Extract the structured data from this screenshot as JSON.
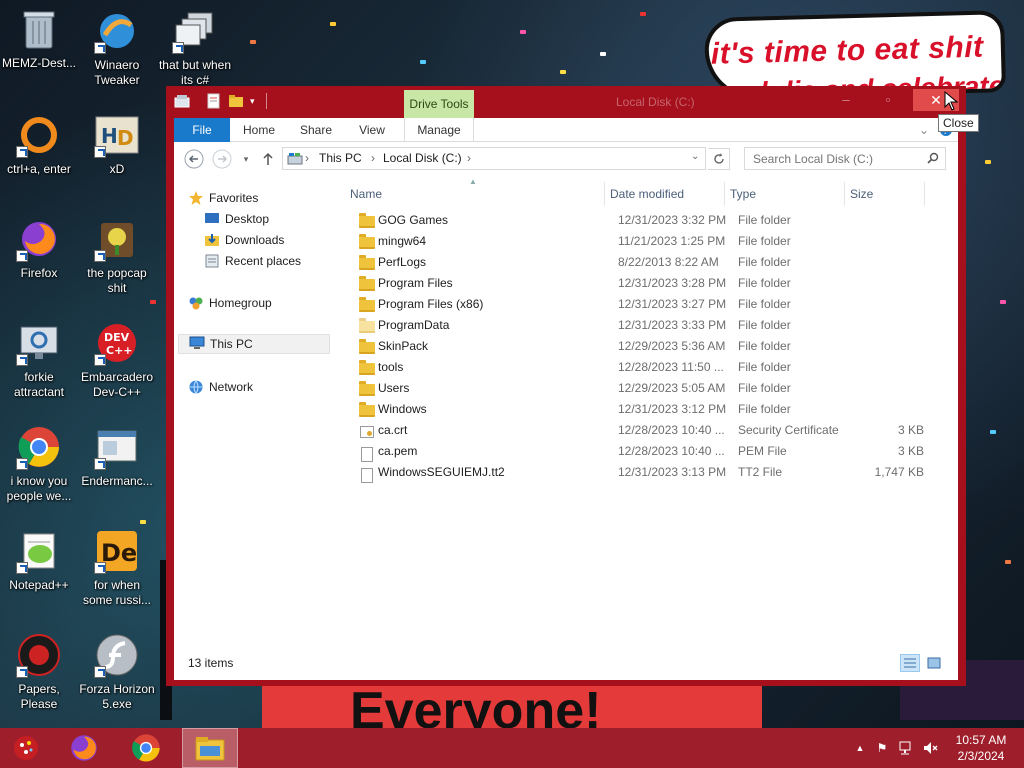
{
  "desktop": {
    "icons": [
      {
        "label": "MEMZ-Dest..."
      },
      {
        "label": "Winaero Tweaker"
      },
      {
        "label": "that but when its c#"
      },
      {
        "label": "ctrl+a, enter"
      },
      {
        "label": "xD"
      },
      {
        "label": "Firefox"
      },
      {
        "label": "the popcap shit"
      },
      {
        "label": "forkie attractant"
      },
      {
        "label": "Embarcadero Dev-C++"
      },
      {
        "label": "i know you people we..."
      },
      {
        "label": "Endermanc..."
      },
      {
        "label": "Notepad++"
      },
      {
        "label": "for when some russi..."
      },
      {
        "label": "Papers, Please"
      },
      {
        "label": "Forza Horizon 5.exe"
      }
    ],
    "wallpaper": {
      "bubble_line1": "it's time to eat shit",
      "bubble_line2": "and die and celebrate",
      "banner": "Everyone!"
    }
  },
  "window": {
    "title": "Local Disk (C:)",
    "context_tab": "Drive Tools",
    "close_tooltip": "Close",
    "ribbon_tabs": [
      "File",
      "Home",
      "Share",
      "View",
      "Manage"
    ],
    "address": {
      "crumbs": [
        "This PC",
        "Local Disk (C:)"
      ]
    },
    "search": {
      "placeholder": "Search Local Disk (C:)"
    },
    "nav_pane": {
      "favorites": "Favorites",
      "favorites_items": [
        "Desktop",
        "Downloads",
        "Recent places"
      ],
      "homegroup": "Homegroup",
      "this_pc": "This PC",
      "network": "Network"
    },
    "columns": {
      "name": "Name",
      "date": "Date modified",
      "type": "Type",
      "size": "Size"
    },
    "files": [
      {
        "name": "GOG Games",
        "date": "12/31/2023 3:32 PM",
        "type": "File folder",
        "size": ""
      },
      {
        "name": "mingw64",
        "date": "11/21/2023 1:25 PM",
        "type": "File folder",
        "size": ""
      },
      {
        "name": "PerfLogs",
        "date": "8/22/2013 8:22 AM",
        "type": "File folder",
        "size": ""
      },
      {
        "name": "Program Files",
        "date": "12/31/2023 3:28 PM",
        "type": "File folder",
        "size": ""
      },
      {
        "name": "Program Files (x86)",
        "date": "12/31/2023 3:27 PM",
        "type": "File folder",
        "size": ""
      },
      {
        "name": "ProgramData",
        "date": "12/31/2023 3:33 PM",
        "type": "File folder",
        "size": ""
      },
      {
        "name": "SkinPack",
        "date": "12/29/2023 5:36 AM",
        "type": "File folder",
        "size": ""
      },
      {
        "name": "tools",
        "date": "12/28/2023 11:50 ...",
        "type": "File folder",
        "size": ""
      },
      {
        "name": "Users",
        "date": "12/29/2023 5:05 AM",
        "type": "File folder",
        "size": ""
      },
      {
        "name": "Windows",
        "date": "12/31/2023 3:12 PM",
        "type": "File folder",
        "size": ""
      },
      {
        "name": "ca.crt",
        "date": "12/28/2023 10:40 ...",
        "type": "Security Certificate",
        "size": "3 KB"
      },
      {
        "name": "ca.pem",
        "date": "12/28/2023 10:40 ...",
        "type": "PEM File",
        "size": "3 KB"
      },
      {
        "name": "WindowsSEGUIEMJ.tt2",
        "date": "12/31/2023 3:13 PM",
        "type": "TT2 File",
        "size": "1,747 KB"
      }
    ],
    "status": {
      "item_count": "13 items"
    }
  },
  "taskbar": {
    "clock_time": "10:57 AM",
    "clock_date": "2/3/2024"
  },
  "colors": {
    "window_frame": "#a6101c",
    "taskbar": "#9e1f2b",
    "file_tab": "#1979ca",
    "drive_tools": "#c8e7a6",
    "close_button": "#e14b4b"
  }
}
